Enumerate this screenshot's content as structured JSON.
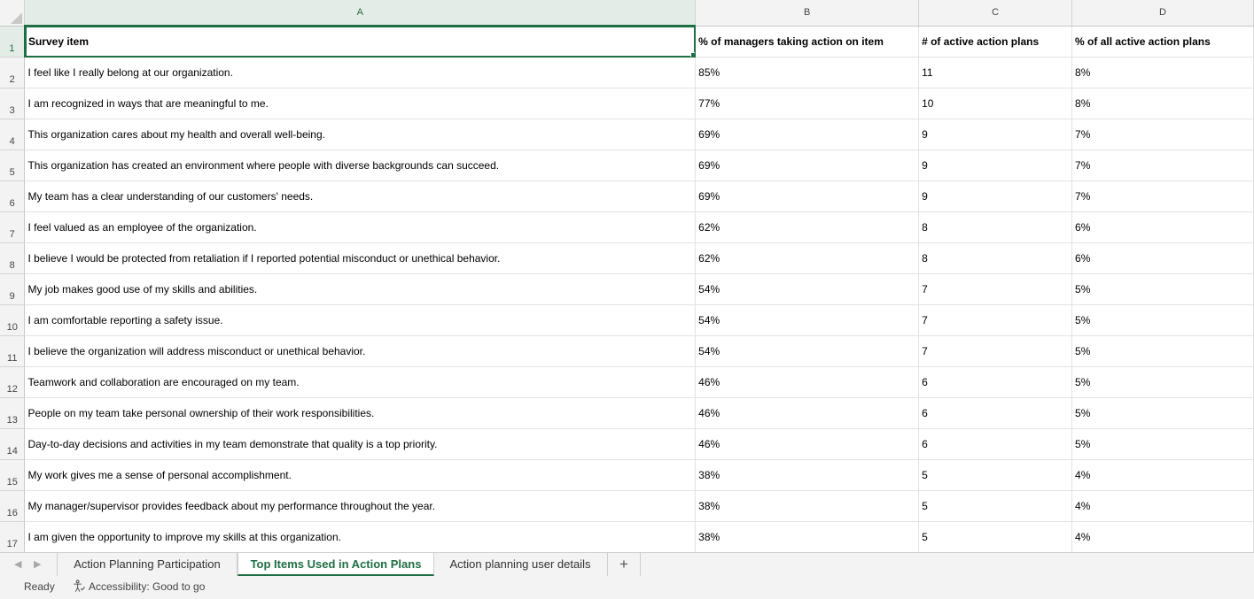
{
  "sheet": {
    "columns": [
      "A",
      "B",
      "C",
      "D"
    ],
    "active_cell": "A1",
    "header_row": {
      "row_number": "1",
      "cells": [
        "Survey item",
        "% of managers taking action on item",
        "# of active action plans",
        "% of all active action plans"
      ]
    },
    "rows": [
      {
        "n": "2",
        "item": "I feel like I really belong at our organization.",
        "pct_managers": "85%",
        "plans": "11",
        "pct_plans": "8%"
      },
      {
        "n": "3",
        "item": "I am recognized in ways that are meaningful to me.",
        "pct_managers": "77%",
        "plans": "10",
        "pct_plans": "8%"
      },
      {
        "n": "4",
        "item": "This organization cares about my health and overall well-being.",
        "pct_managers": "69%",
        "plans": "9",
        "pct_plans": "7%"
      },
      {
        "n": "5",
        "item": "This organization has created an environment where people with diverse backgrounds can succeed.",
        "pct_managers": "69%",
        "plans": "9",
        "pct_plans": "7%"
      },
      {
        "n": "6",
        "item": "My team has a clear understanding of our customers' needs.",
        "pct_managers": "69%",
        "plans": "9",
        "pct_plans": "7%"
      },
      {
        "n": "7",
        "item": "I feel valued as an employee of the organization.",
        "pct_managers": "62%",
        "plans": "8",
        "pct_plans": "6%"
      },
      {
        "n": "8",
        "item": "I believe I would be protected from retaliation if I reported potential misconduct or unethical behavior.",
        "pct_managers": "62%",
        "plans": "8",
        "pct_plans": "6%"
      },
      {
        "n": "9",
        "item": "My job makes good use of my skills and abilities.",
        "pct_managers": "54%",
        "plans": "7",
        "pct_plans": "5%"
      },
      {
        "n": "10",
        "item": "I am comfortable reporting a safety issue.",
        "pct_managers": "54%",
        "plans": "7",
        "pct_plans": "5%"
      },
      {
        "n": "11",
        "item": "I believe the organization will address misconduct or unethical behavior.",
        "pct_managers": "54%",
        "plans": "7",
        "pct_plans": "5%"
      },
      {
        "n": "12",
        "item": "Teamwork and collaboration are encouraged on my team.",
        "pct_managers": "46%",
        "plans": "6",
        "pct_plans": "5%"
      },
      {
        "n": "13",
        "item": "People on my team take personal ownership of their work responsibilities.",
        "pct_managers": "46%",
        "plans": "6",
        "pct_plans": "5%"
      },
      {
        "n": "14",
        "item": "Day-to-day decisions and activities in my team demonstrate that quality is a top priority.",
        "pct_managers": "46%",
        "plans": "6",
        "pct_plans": "5%"
      },
      {
        "n": "15",
        "item": "My work gives me a sense of personal accomplishment.",
        "pct_managers": "38%",
        "plans": "5",
        "pct_plans": "4%"
      },
      {
        "n": "16",
        "item": "My manager/supervisor provides feedback about my performance throughout the year.",
        "pct_managers": "38%",
        "plans": "5",
        "pct_plans": "4%"
      },
      {
        "n": "17",
        "item": "I am given the opportunity to improve my skills at this organization.",
        "pct_managers": "38%",
        "plans": "5",
        "pct_plans": "4%"
      }
    ]
  },
  "tabs": [
    {
      "label": "Action Planning Participation",
      "active": false
    },
    {
      "label": "Top Items Used in Action Plans",
      "active": true
    },
    {
      "label": "Action planning user details",
      "active": false
    }
  ],
  "add_tab_label": "+",
  "status": {
    "ready": "Ready",
    "accessibility": "Accessibility: Good to go"
  },
  "colors": {
    "accent": "#1e6e43",
    "header_bg": "#f3f3f3"
  },
  "icons": {
    "prev_sheet": "triangle-left-icon",
    "next_sheet": "triangle-right-icon",
    "accessibility": "accessibility-person-icon"
  }
}
